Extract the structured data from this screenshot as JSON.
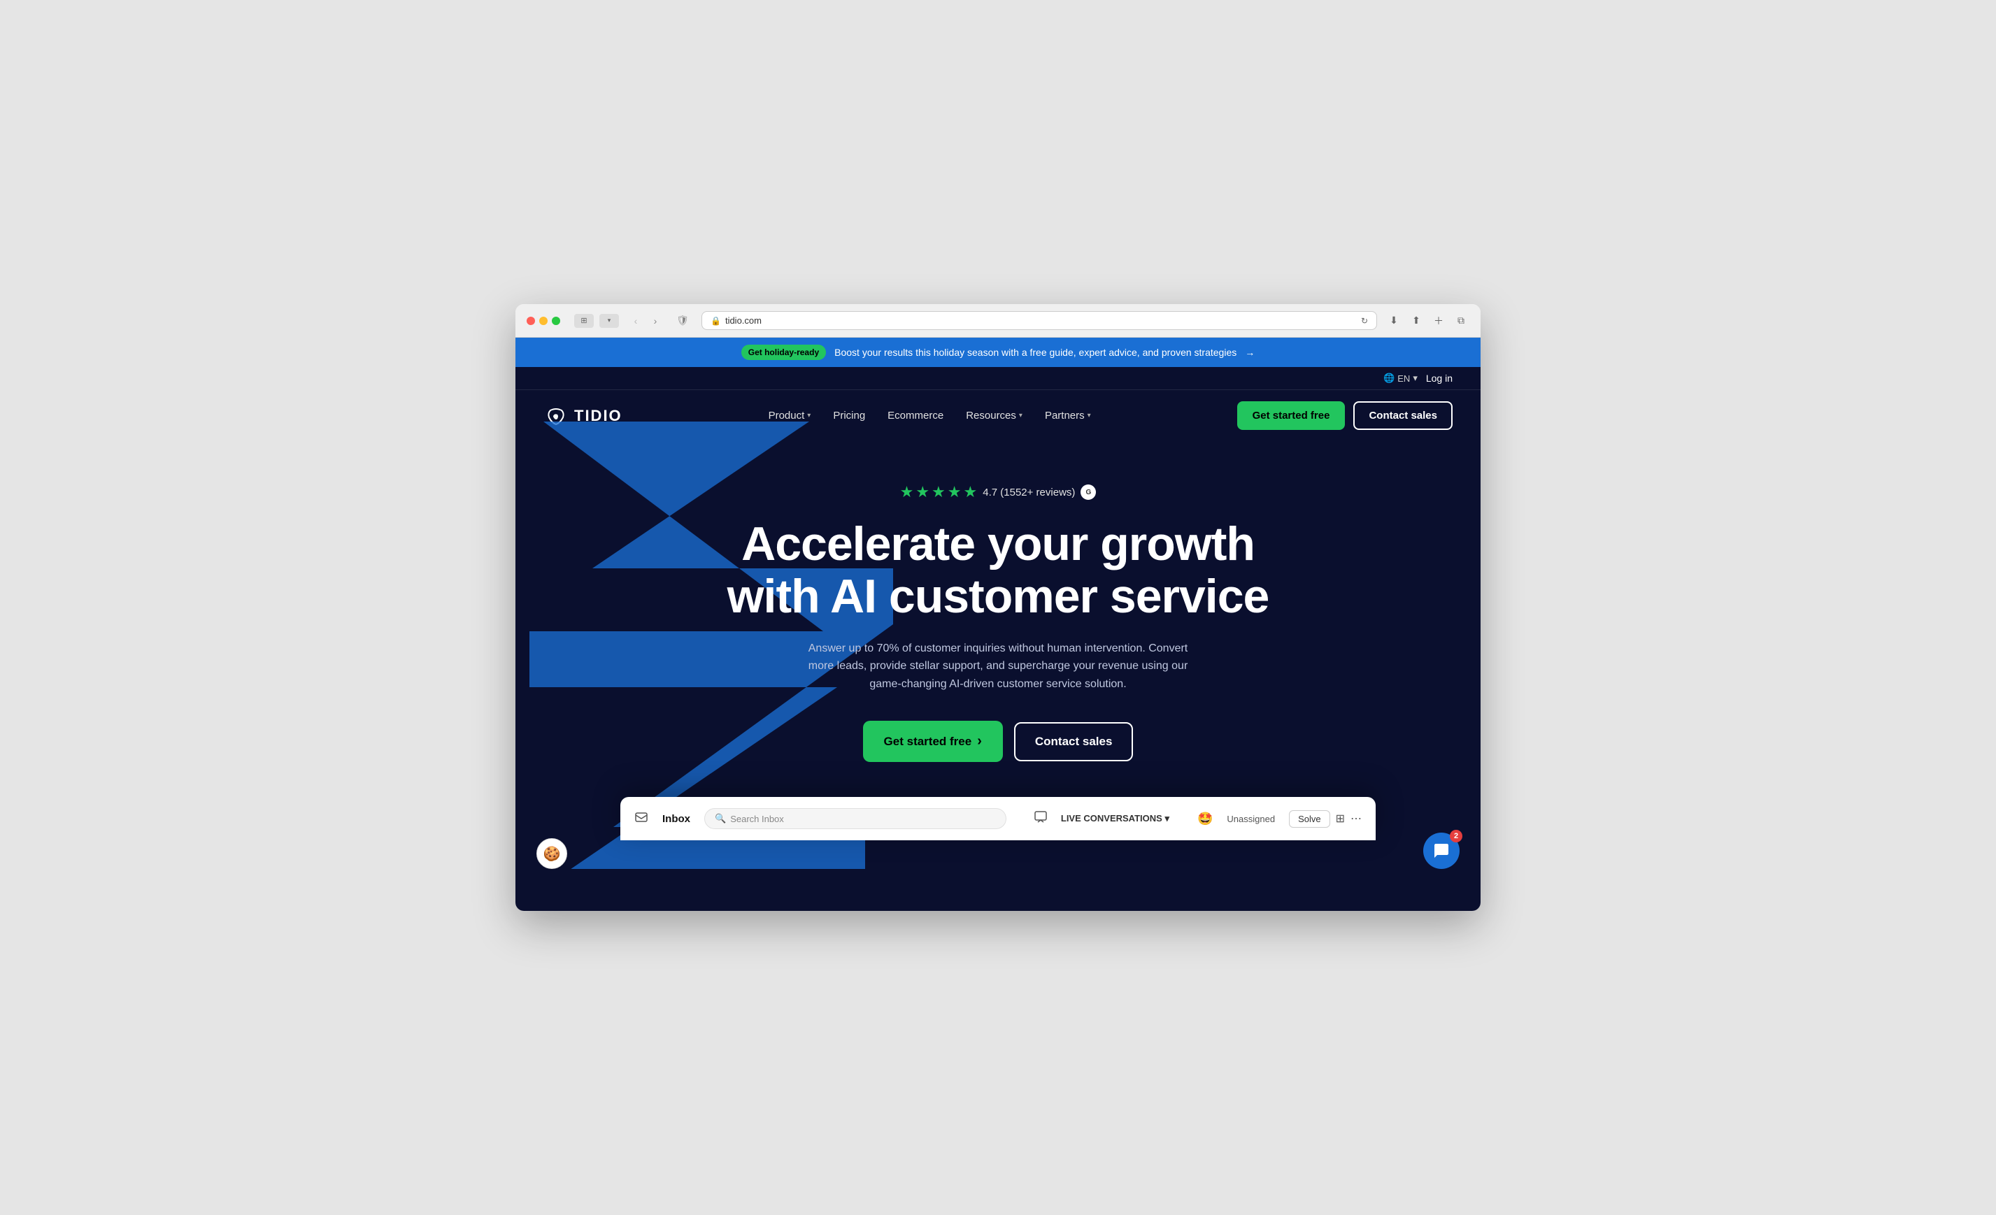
{
  "browser": {
    "url": "tidio.com",
    "reload_label": "↻"
  },
  "announcement": {
    "badge_label": "Get holiday-ready",
    "text": "Boost your results this holiday season with a free guide, expert advice, and proven strategies",
    "arrow": "→"
  },
  "utility_bar": {
    "language": "EN",
    "login_label": "Log in"
  },
  "logo": {
    "text": "TIDIO"
  },
  "nav": {
    "items": [
      {
        "label": "Product",
        "has_dropdown": true
      },
      {
        "label": "Pricing",
        "has_dropdown": false
      },
      {
        "label": "Ecommerce",
        "has_dropdown": false
      },
      {
        "label": "Resources",
        "has_dropdown": true
      },
      {
        "label": "Partners",
        "has_dropdown": true
      }
    ],
    "get_started_label": "Get started free",
    "contact_sales_label": "Contact sales"
  },
  "hero": {
    "rating": "4.7 (1552+ reviews)",
    "star_count": 5,
    "title_line1": "Accelerate your growth",
    "title_line2": "with AI customer service",
    "subtitle": "Answer up to 70% of customer inquiries without human intervention. Convert more leads, provide stellar support, and supercharge your revenue using our game-changing AI-driven customer service solution.",
    "cta_primary": "Get started free",
    "cta_secondary": "Contact sales",
    "cta_arrow": "›"
  },
  "inbox_preview": {
    "title": "Inbox",
    "search_placeholder": "Search Inbox",
    "conversations_label": "LIVE CONVERSATIONS",
    "unassigned_label": "Unassigned",
    "solve_label": "Solve"
  },
  "chat_widget": {
    "badge_count": "2"
  },
  "cookie_icon": "🍪"
}
